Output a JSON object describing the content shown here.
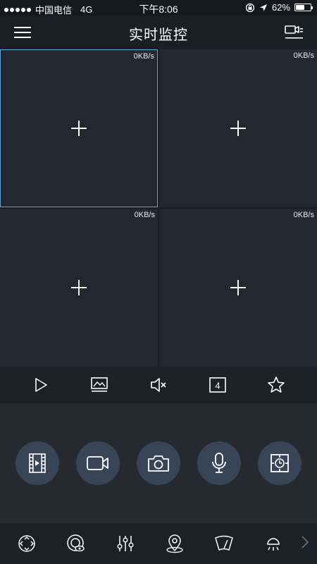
{
  "status_bar": {
    "carrier": "中国电信",
    "network": "4G",
    "time": "下午8:06",
    "battery": "62%",
    "battery_level": 0.62
  },
  "nav": {
    "title": "实时监控",
    "menu_icon": "hamburger-menu-icon",
    "device_icon": "device-list-icon"
  },
  "grid": {
    "cells": [
      {
        "rate": "0KB/s",
        "selected": true
      },
      {
        "rate": "0KB/s",
        "selected": false
      },
      {
        "rate": "0KB/s",
        "selected": false
      },
      {
        "rate": "0KB/s",
        "selected": false
      }
    ]
  },
  "toolbar": {
    "items": [
      "play-icon",
      "picture-quality-icon",
      "mute-icon",
      "split-screen-icon",
      "favorite-star-icon"
    ],
    "split_count": "4"
  },
  "actions": {
    "items": [
      "playback-icon",
      "video-record-icon",
      "camera-snapshot-icon",
      "microphone-icon",
      "cloud-terminal-icon"
    ]
  },
  "features": {
    "items": [
      "ptz-direction-icon",
      "fisheye-icon",
      "adjust-sliders-icon",
      "location-icon",
      "wiper-icon",
      "light-icon"
    ]
  },
  "colors": {
    "accent": "#5aa8d8",
    "background": "#1b1e24",
    "cell": "#232730",
    "action_button": "#384557"
  }
}
